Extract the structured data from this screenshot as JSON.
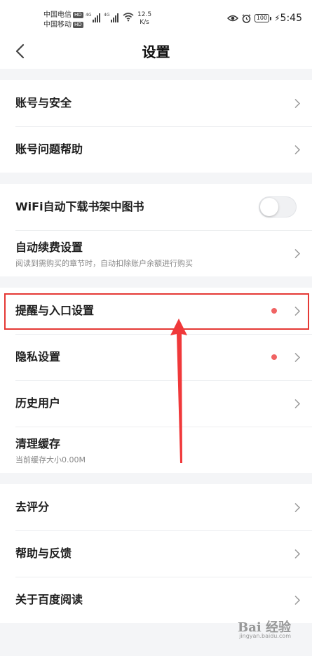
{
  "status_bar": {
    "carrier1": "中国电信",
    "carrier2": "中国移动",
    "hd": "HD",
    "net1": "4G",
    "net2": "4G",
    "speed_value": "12.5",
    "speed_unit": "K/s",
    "battery": "100",
    "time": "5:45"
  },
  "header": {
    "title": "设置"
  },
  "groups": [
    {
      "items": [
        {
          "label": "账号与安全"
        },
        {
          "label": "账号问题帮助"
        }
      ]
    },
    {
      "items": [
        {
          "label": "WiFi自动下载书架中图书",
          "toggle_on": false
        },
        {
          "label": "自动续费设置",
          "sub": "阅读到需购买的章节时，自动扣除账户余额进行购买"
        }
      ]
    },
    {
      "items": [
        {
          "label": "提醒与入口设置",
          "badge": true
        },
        {
          "label": "隐私设置",
          "badge": true
        },
        {
          "label": "历史用户"
        },
        {
          "label": "清理缓存",
          "sub": "当前缓存大小0.00M"
        }
      ]
    },
    {
      "items": [
        {
          "label": "去评分"
        },
        {
          "label": "帮助与反馈"
        },
        {
          "label": "关于百度阅读"
        }
      ]
    }
  ],
  "colors": {
    "badge": "#f06363",
    "highlight": "#e53935",
    "background": "#f4f5f7"
  },
  "watermark": {
    "logo": "Bai 经验",
    "url": "jingyan.baidu.com"
  }
}
